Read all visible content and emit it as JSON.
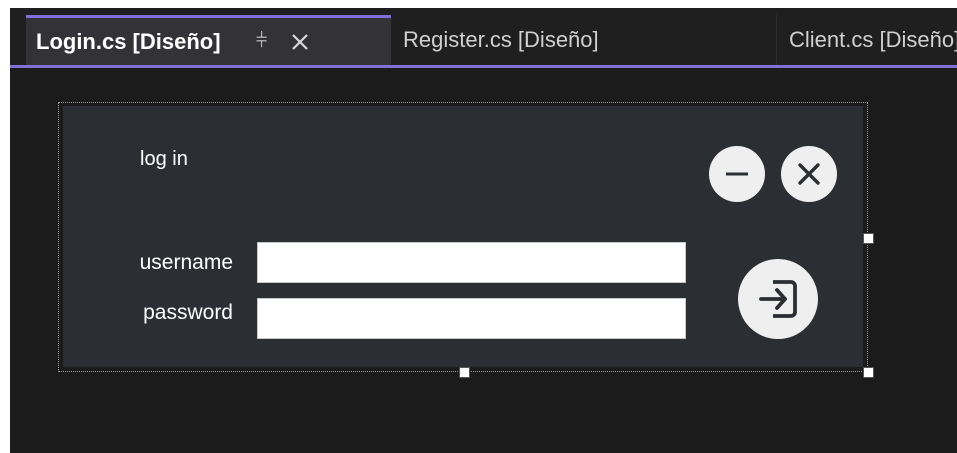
{
  "tabs": [
    {
      "label": "Login.cs [Diseño]",
      "active": true
    },
    {
      "label": "Register.cs [Diseño]",
      "active": false
    },
    {
      "label": "Client.cs [Diseño]",
      "active": false
    }
  ],
  "tab_icons": {
    "pin": "pin-icon",
    "close": "close-icon"
  },
  "colors": {
    "accent": "#8070d8",
    "editor_background": "#1b1b1b",
    "form_background": "#2b2e33",
    "button_fill": "#efefef"
  },
  "form": {
    "title": "log in",
    "username_label": "username",
    "password_label": "password",
    "username_value": "",
    "password_value": "",
    "icons": {
      "minimize": "minus-circle-icon",
      "close": "x-circle-icon",
      "login": "sign-in-icon"
    }
  }
}
